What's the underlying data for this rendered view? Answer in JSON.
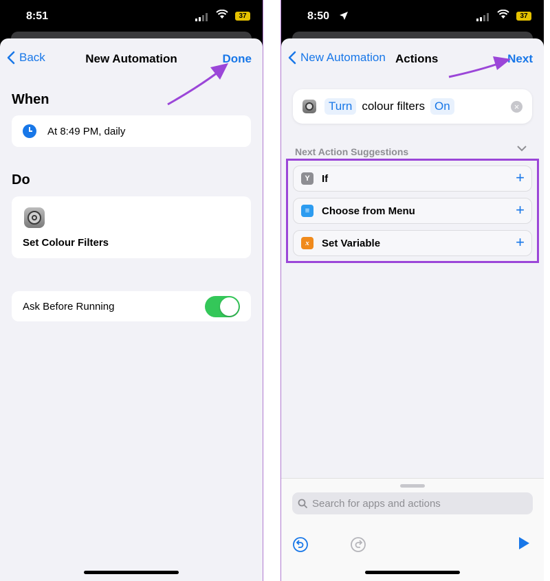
{
  "left": {
    "status_time": "8:51",
    "battery": "37",
    "nav": {
      "back_label": "Back",
      "title": "New Automation",
      "done_label": "Done"
    },
    "when": {
      "heading": "When",
      "trigger": "At 8:49 PM, daily"
    },
    "do": {
      "heading": "Do",
      "action": "Set Colour Filters"
    },
    "ask_before_running": {
      "label": "Ask Before Running",
      "enabled": true
    }
  },
  "right": {
    "status_time": "8:50",
    "battery": "37",
    "nav": {
      "back_label": "New Automation",
      "title": "Actions",
      "next_label": "Next"
    },
    "action": {
      "verb": "Turn",
      "object": "colour filters",
      "state": "On"
    },
    "suggestions_heading": "Next Action Suggestions",
    "suggestions": [
      {
        "label": "If",
        "icon": "branch-icon",
        "color": "#8e8e93",
        "glyph": "Y"
      },
      {
        "label": "Choose from Menu",
        "icon": "menu-icon",
        "color": "#2d9cf0",
        "glyph": "≡"
      },
      {
        "label": "Set Variable",
        "icon": "variable-icon",
        "color": "#f08a1c",
        "glyph": "x"
      }
    ],
    "search_placeholder": "Search for apps and actions"
  },
  "colors": {
    "accent": "#1877e8",
    "highlight": "#9b46d8",
    "toggle_on": "#34c759",
    "arrow": "#9b46d8"
  }
}
